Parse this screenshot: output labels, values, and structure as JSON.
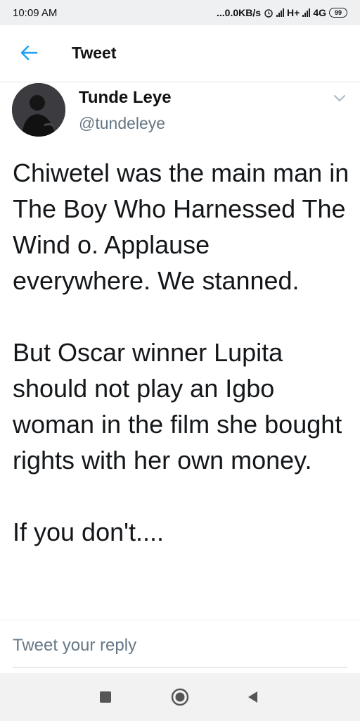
{
  "status_bar": {
    "time": "10:09 AM",
    "speed": "...0.0KB/s",
    "network1": "H+",
    "network2": "4G",
    "battery": "99"
  },
  "header": {
    "title": "Tweet",
    "back_icon": "arrow-left-icon",
    "accent": "#1da1f2"
  },
  "tweet": {
    "author": {
      "name": "Tunde Leye",
      "handle": "@tundeleye"
    },
    "paragraphs": [
      "Chiwetel was the main man in The Boy Who Harnessed The Wind o. Applause everywhere. We stanned.",
      "But Oscar winner Lupita should not play an Igbo woman in the film she bought rights with her own money.",
      "If you don't...."
    ]
  },
  "reply": {
    "placeholder": "Tweet your reply"
  },
  "nav": {
    "icons": [
      "recents-square-icon",
      "home-circle-icon",
      "back-triangle-icon"
    ]
  }
}
